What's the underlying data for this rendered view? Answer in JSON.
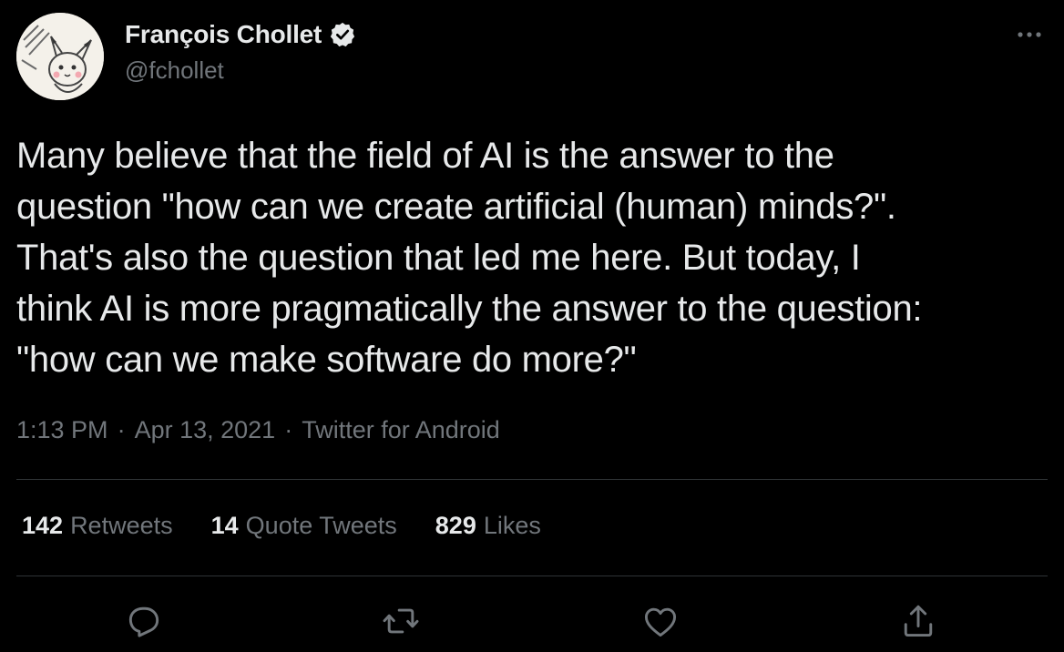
{
  "author": {
    "name": "François Chollet",
    "handle": "@fchollet",
    "verified": true,
    "avatar_icon": "pikachu-avatar"
  },
  "tweet": {
    "text": "Many believe that the field of AI is the answer to the\nquestion \"how can we create artificial (human) minds?\".\nThat's also the question that led me here. But today, I\nthink AI is more pragmatically the answer to the question:\n\"how can we make software do more?\"",
    "time": "1:13 PM",
    "date": "Apr 13, 2021",
    "source": "Twitter for Android",
    "separator": "·"
  },
  "stats": {
    "retweets": {
      "count": "142",
      "label": "Retweets"
    },
    "quote_tweets": {
      "count": "14",
      "label": "Quote Tweets"
    },
    "likes": {
      "count": "829",
      "label": "Likes"
    }
  },
  "actions": [
    "reply-icon",
    "retweet-icon",
    "like-icon",
    "share-icon"
  ],
  "colors": {
    "background": "#000000",
    "primary_text": "#e7e9ea",
    "secondary_text": "#71767b",
    "divider": "#2f3336"
  }
}
